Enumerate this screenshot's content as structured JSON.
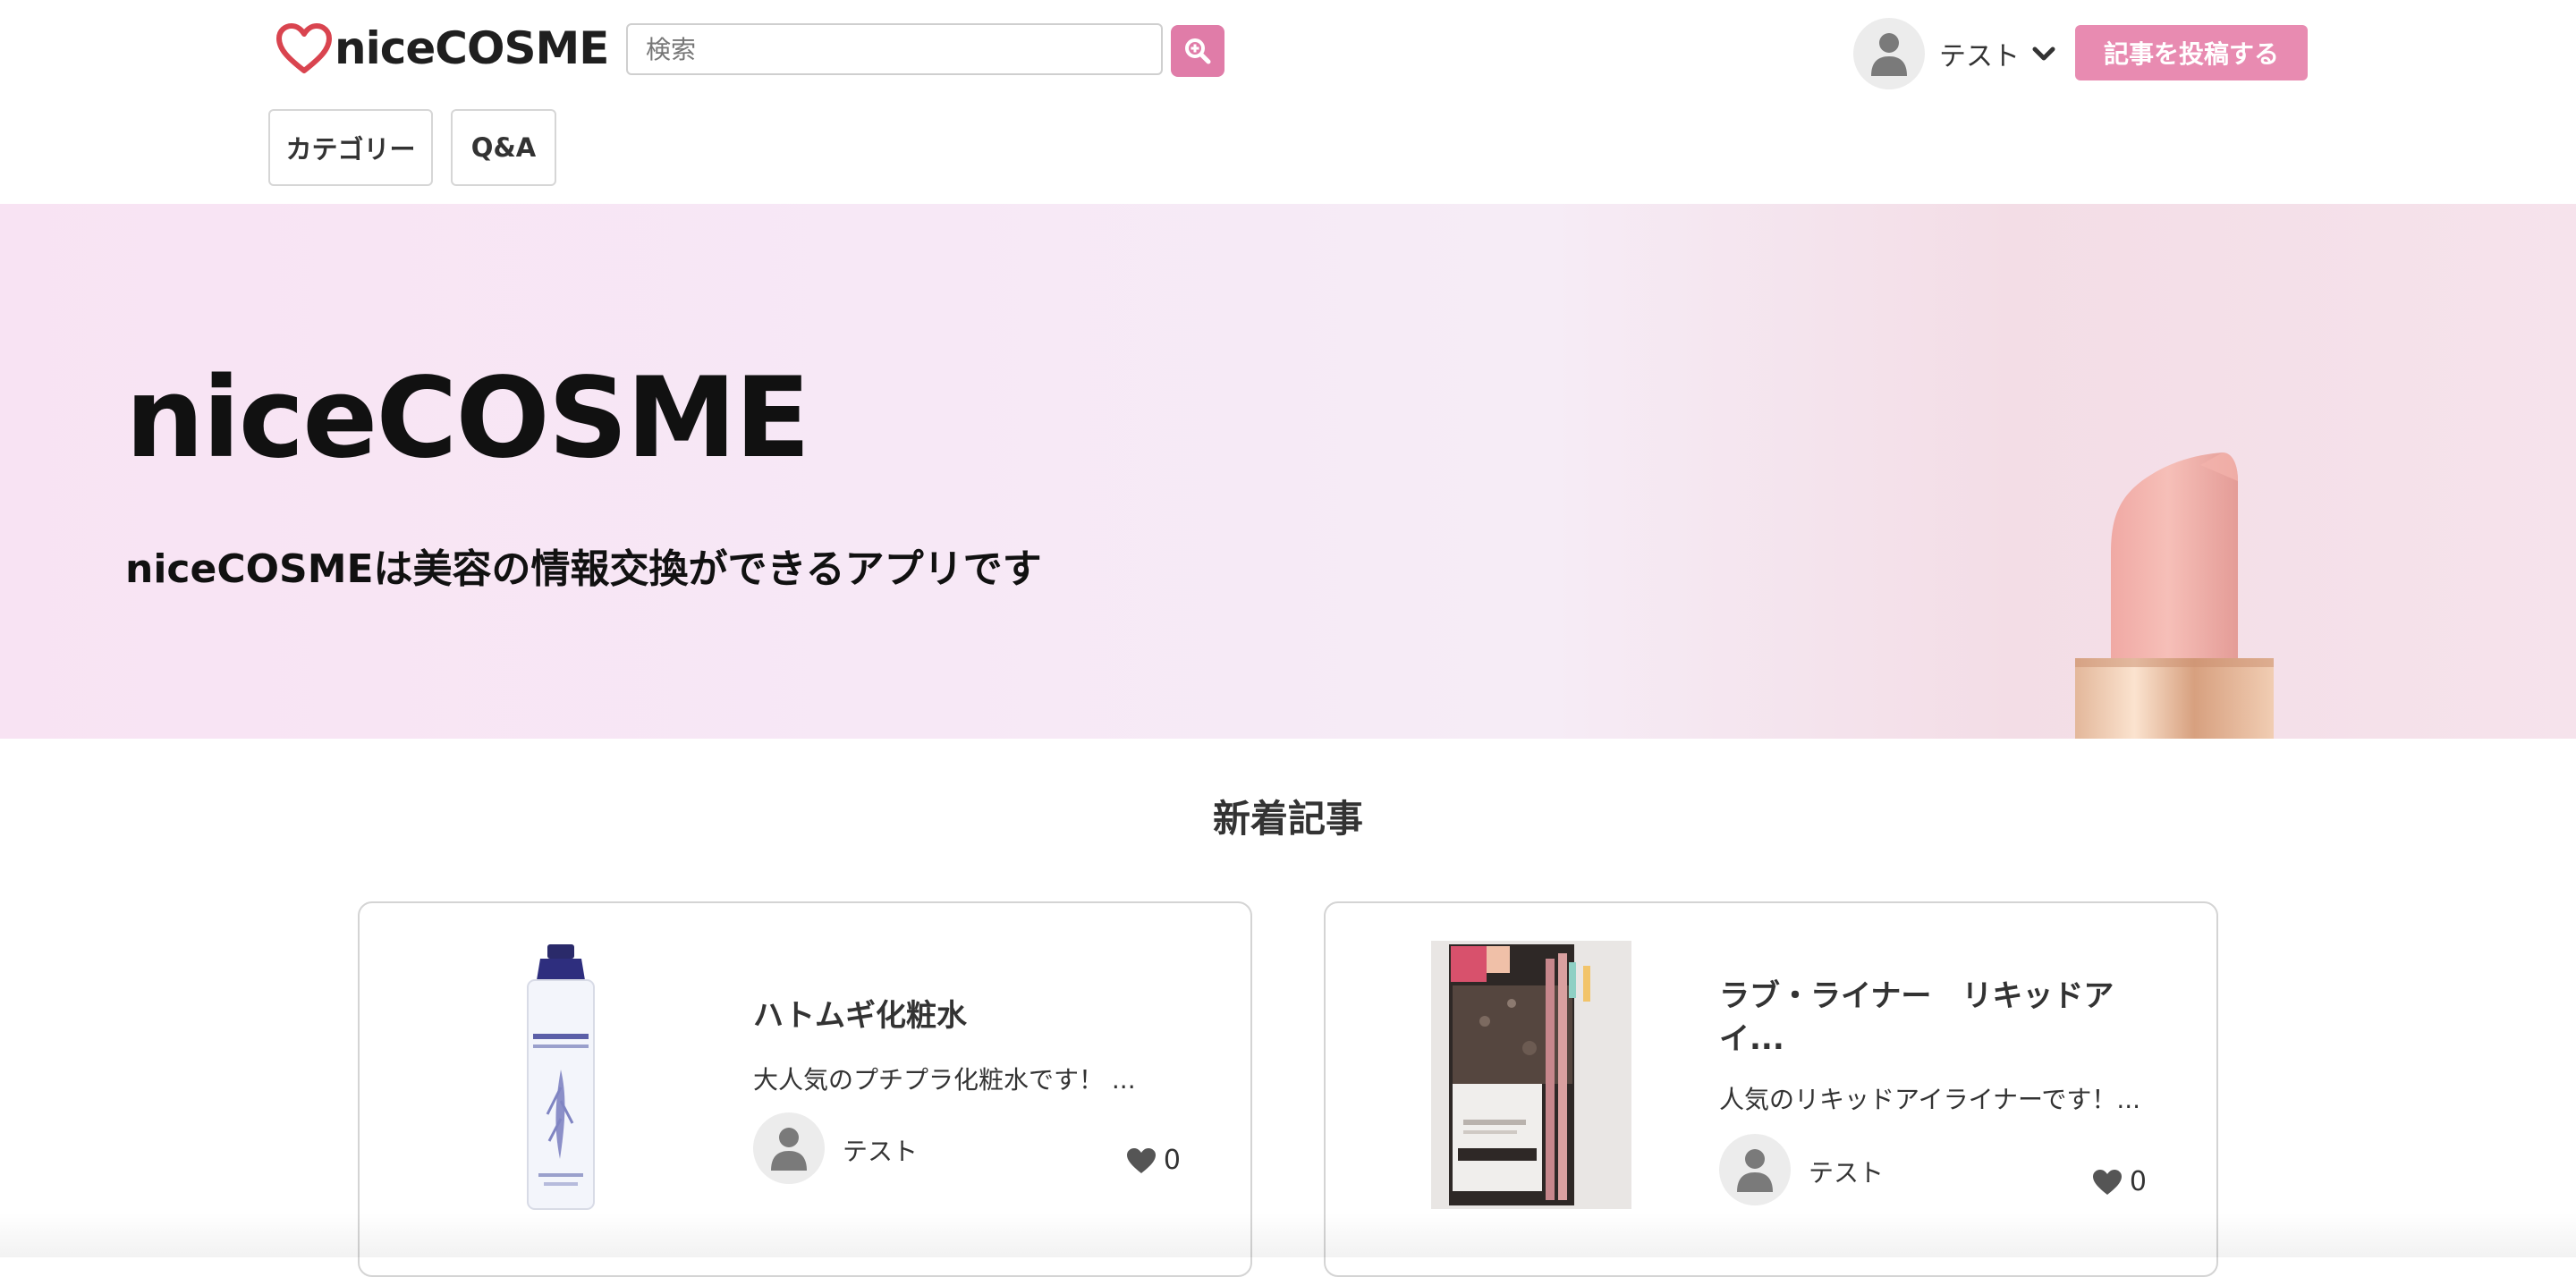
{
  "header": {
    "logo_text": "niceCOSME",
    "search": {
      "placeholder": "検索",
      "value": ""
    },
    "search_icon": "magnifier-plus-icon",
    "nav": [
      {
        "label": "カテゴリー"
      },
      {
        "label": "Q&A"
      }
    ],
    "user": {
      "name": "テスト",
      "avatar_icon": "user-silhouette-icon",
      "dropdown_icon": "chevron-down-icon"
    },
    "post_button": "記事を投稿する"
  },
  "hero": {
    "title": "niceCOSME",
    "subtitle": "niceCOSMEは美容の情報交換ができるアプリです"
  },
  "section": {
    "title": "新着記事"
  },
  "articles": [
    {
      "title": "ハトムギ化粧水",
      "excerpt": "大人気のプチプラ化粧水です！ ...",
      "author": "テスト",
      "likes": "0"
    },
    {
      "title": "ラブ・ライナー　リキッドアイ...",
      "excerpt": "人気のリキッドアイライナーです！...",
      "author": "テスト",
      "likes": "0"
    }
  ],
  "colors": {
    "accent": "#e07ca8",
    "post_button": "#e88bb1",
    "logo_heart": "#d9444f",
    "hero_background": "#f7e6f5"
  }
}
